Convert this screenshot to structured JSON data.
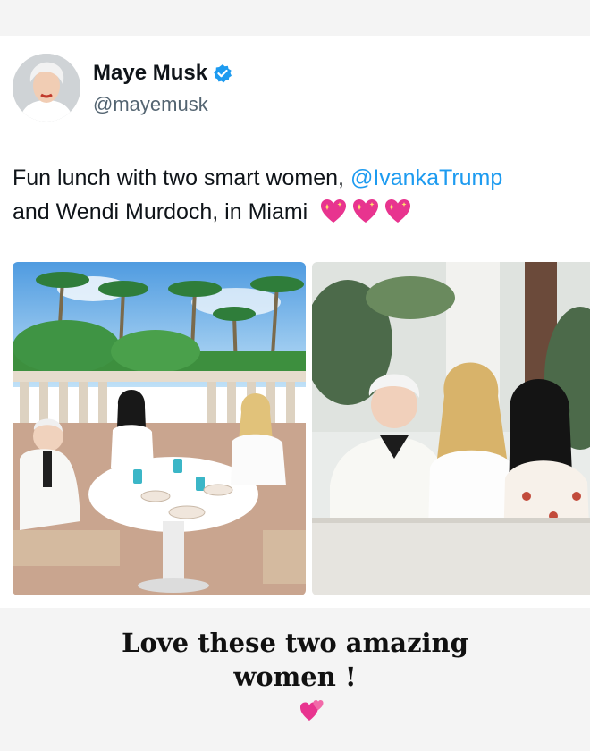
{
  "tweet": {
    "author_name": "Maye Musk",
    "handle": "@mayemusk",
    "text_line1": "Fun lunch with two smart women,",
    "mention": "@IvankaTrump",
    "text_line2": "and Wendi Murdoch, in Miami",
    "emoji": [
      "sparkling-heart",
      "sparkling-heart",
      "sparkling-heart"
    ]
  },
  "story_caption": {
    "line1": "Love these two amazing",
    "line2": "women !",
    "emoji": "two-hearts"
  },
  "colors": {
    "mention": "#1d9bf0",
    "verified_badge": "#1d9bf0",
    "heart": "#e8348f"
  }
}
